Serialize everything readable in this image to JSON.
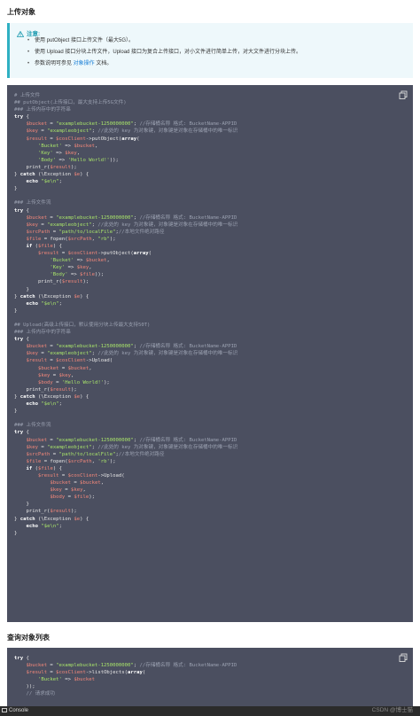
{
  "section1_title": "上传对象",
  "note": {
    "heading": "注意:",
    "items": [
      {
        "text": "使用 putObject 接口上传文件（最大5G）。"
      },
      {
        "text": "使用 Upload 接口分块上传文件，Upload 接口为复合上传接口，对小文件进行简单上传，对大文件进行分块上传。"
      },
      {
        "prefix": "参数说明可参见 ",
        "link": "对象操作",
        "suffix": " 文档。"
      }
    ]
  },
  "code1": "# 上传文件\n## putObject(上传接口，最大支持上传5G文件)\n### 上传内存中的字符串\ntry {\n    $bucket = \"examplebucket-1250000000\"; //存储桶名称 格式: BucketName-APPID\n    $key = \"exampleobject\"; //此处的 key 为对象键，对象键是对象在存储桶中的唯一标识\n    $result = $cosClient->putObject(array(\n        'Bucket' => $bucket,\n        'Key' => $key,\n        'Body' => 'Hello World!'));\n    print_r($result);\n} catch (\\Exception $e) {\n    echo \"$e\\n\";\n}\n\n### 上传文件流\ntry {\n    $bucket = \"examplebucket-1250000000\"; //存储桶名称 格式: BucketName-APPID\n    $key = \"exampleobject\"; //此处的 key 为对象键，对象键是对象在存储桶中的唯一标识\n    $srcPath = \"path/to/localFile\";//本地文件绝对路径\n    $file = fopen($srcPath, \"rb\");\n    if ($file) {\n        $result = $cosClient->putObject(array(\n            'Bucket' => $bucket,\n            'Key' => $key,\n            'Body' => $file));\n        print_r($result);\n    }\n} catch (\\Exception $e) {\n    echo \"$e\\n\";\n}\n\n## Upload(高级上传接口，默认使用分块上传最大支持50T)\n### 上传内存中的字符串\ntry {\n    $bucket = \"examplebucket-1250000000\"; //存储桶名称 格式: BucketName-APPID\n    $key = \"exampleobject\"; //此处的 key 为对象键，对象键是对象在存储桶中的唯一标识\n    $result = $cosClient->Upload(\n        $bucket = $bucket,\n        $key = $key,\n        $body = 'Hello World!');\n    print_r($result);\n} catch (\\Exception $e) {\n    echo \"$e\\n\";\n}\n\n### 上传文件流\ntry {\n    $bucket = \"examplebucket-1250000000\"; //存储桶名称 格式: BucketName-APPID\n    $key = \"exampleobject\"; //此处的 key 为对象键，对象键是对象在存储桶中的唯一标识\n    $srcPath = \"path/to/localFile\";//本地文件绝对路径\n    $file = fopen($srcPath, 'rb');\n    if ($file) {\n        $result = $cosClient->Upload(\n            $bucket = $bucket,\n            $key = $key,\n            $body = $file);\n    }\n    print_r($result);\n} catch (\\Exception $e) {\n    echo \"$e\\n\";\n}",
  "section2_title": "查询对象列表",
  "code2": "try {\n    $bucket = \"examplebucket-1250000000\"; //存储桶名称 格式: BucketName-APPID\n    $result = $cosClient->listObjects(array(\n        'Bucket' => $bucket\n    ));\n    // 请求成功",
  "bottom_bar": {
    "console_label": "Console"
  },
  "watermark": "CSDN @博士猫",
  "colors": {
    "code_bg": "#4b4f60",
    "note_bg": "#eef8fb",
    "note_accent": "#2fb0c2",
    "link": "#1a7fd6"
  }
}
